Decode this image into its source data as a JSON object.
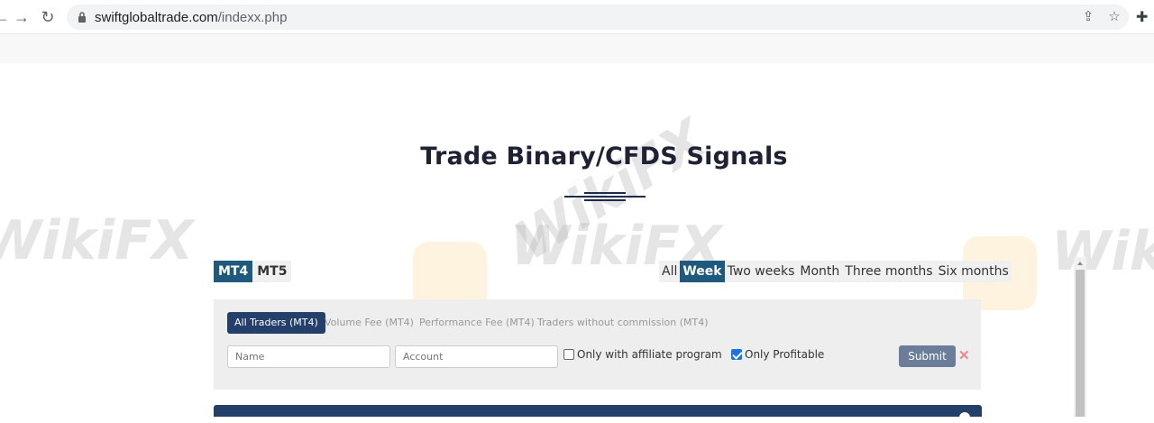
{
  "browser": {
    "url_domain": "swiftglobaltrade.com",
    "url_path": "/indexx.php"
  },
  "watermark": {
    "text": "WikiFX"
  },
  "page": {
    "title": "Trade Binary/CFDS Signals"
  },
  "platform_tabs": [
    {
      "label": "MT4",
      "active": true
    },
    {
      "label": "MT5",
      "active": false
    }
  ],
  "period_tabs": [
    {
      "label": "All",
      "active": false
    },
    {
      "label": "Week",
      "active": true
    },
    {
      "label": "Two weeks",
      "active": false
    },
    {
      "label": "Month",
      "active": false
    },
    {
      "label": "Three months",
      "active": false
    },
    {
      "label": "Six months",
      "active": false
    }
  ],
  "filter": {
    "tabs": [
      {
        "label": "All Traders (MT4)",
        "active": true
      },
      {
        "label": "Volume Fee (MT4)",
        "active": false
      },
      {
        "label": "Performance Fee (MT4)",
        "active": false
      },
      {
        "label": "Traders without commission (MT4)",
        "active": false
      }
    ],
    "name_placeholder": "Name",
    "account_placeholder": "Account",
    "affiliate_label": "Only with affiliate program",
    "affiliate_checked": false,
    "profitable_label": "Only Profitable",
    "profitable_checked": true,
    "submit_label": "Submit",
    "clear_symbol": "✕"
  },
  "colors": {
    "active_tab": "#1e5a7e",
    "panel_header": "#24406a"
  }
}
